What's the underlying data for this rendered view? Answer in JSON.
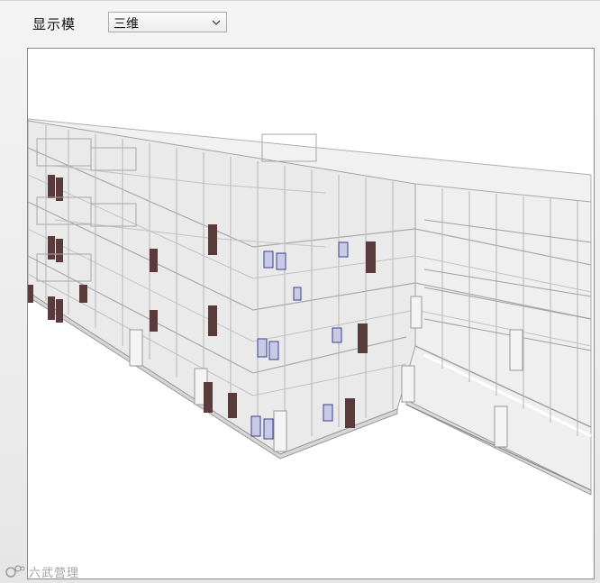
{
  "toolbar": {
    "display_mode_label": "显示模",
    "display_mode_value": "三维"
  },
  "icons": {
    "dropdown": "chevron-down-icon",
    "watermark_logo": "bim-logo-icon"
  },
  "watermark": {
    "text": "六武营理"
  },
  "colors": {
    "door": "#5a3a3a",
    "window": "#3c3f8c",
    "wireframe": "#9a9a9a",
    "glass": "#e7e7e7"
  }
}
